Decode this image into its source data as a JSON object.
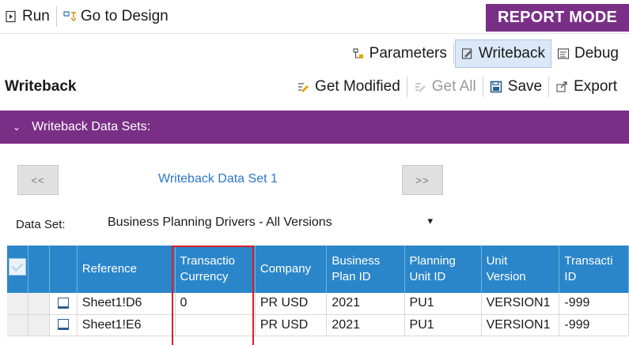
{
  "toolbar": {
    "run_label": "Run",
    "go_to_design_label": "Go to Design",
    "mode_badge": "REPORT MODE"
  },
  "view_tabs": {
    "parameters_label": "Parameters",
    "writeback_label": "Writeback",
    "debug_label": "Debug"
  },
  "writeback_bar": {
    "title": "Writeback",
    "get_modified_label": "Get Modified",
    "get_all_label": "Get All",
    "save_label": "Save",
    "export_label": "Export"
  },
  "section": {
    "header": "Writeback Data Sets:",
    "chevron": "⌄"
  },
  "navigator": {
    "prev_label": "<<",
    "next_label": ">>",
    "current_title": "Writeback Data Set 1"
  },
  "dataset": {
    "label": "Data Set:",
    "selected_value": "Business Planning Drivers - All Versions",
    "dropdown_arrow": "▾"
  },
  "grid": {
    "columns": [
      {
        "line1": "Reference",
        "line2": ""
      },
      {
        "line1": "Transactio",
        "line2": "Currency"
      },
      {
        "line1": "Company",
        "line2": ""
      },
      {
        "line1": "Business",
        "line2": "Plan ID"
      },
      {
        "line1": "Planning",
        "line2": "Unit ID"
      },
      {
        "line1": "Unit",
        "line2": "Version"
      },
      {
        "line1": "Transacti",
        "line2": "ID"
      }
    ],
    "rows": [
      {
        "reference": "Sheet1!D6",
        "currency": "0",
        "company": "PR USD",
        "plan_id": "2021",
        "unit_id": "PU1",
        "version": "VERSION1",
        "transaction_id": "-999"
      },
      {
        "reference": "Sheet1!E6",
        "currency": "",
        "company": "PR USD",
        "plan_id": "2021",
        "unit_id": "PU1",
        "version": "VERSION1",
        "transaction_id": "-999"
      }
    ]
  },
  "colors": {
    "accent_purple": "#7a2f86",
    "grid_header_blue": "#2b86c9",
    "link_blue": "#2b78c9",
    "highlight_red": "#d81e28"
  },
  "icons": {
    "run": "run-icon",
    "go_to_design": "design-icon",
    "parameters": "parameters-icon",
    "writeback": "writeback-icon",
    "debug": "debug-icon",
    "get_modified": "get-modified-icon",
    "get_all": "get-all-icon",
    "save": "save-icon",
    "export": "export-icon"
  }
}
